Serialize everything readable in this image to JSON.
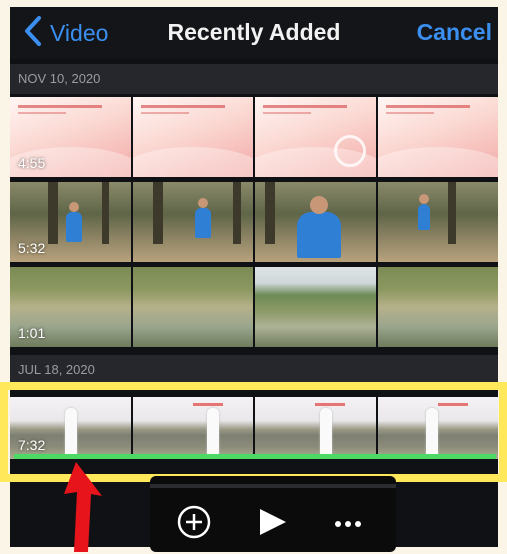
{
  "navbar": {
    "back_label": "Video",
    "title": "Recently Added",
    "cancel_label": "Cancel"
  },
  "sections": [
    {
      "date": "NOV 10, 2020"
    },
    {
      "date": "JUL 18, 2020"
    }
  ],
  "clips": [
    {
      "duration": "4:55"
    },
    {
      "duration": "5:32"
    },
    {
      "duration": "1:01"
    },
    {
      "duration": "7:32"
    }
  ],
  "toolbar": {
    "add_icon": "plus-circle-icon",
    "play_icon": "play-icon",
    "more_icon": "ellipsis-icon"
  },
  "colors": {
    "accent": "#3a8ff0",
    "highlight": "#ffe85a",
    "annotation_arrow": "#e8141b",
    "trim_line": "#4cd964"
  }
}
